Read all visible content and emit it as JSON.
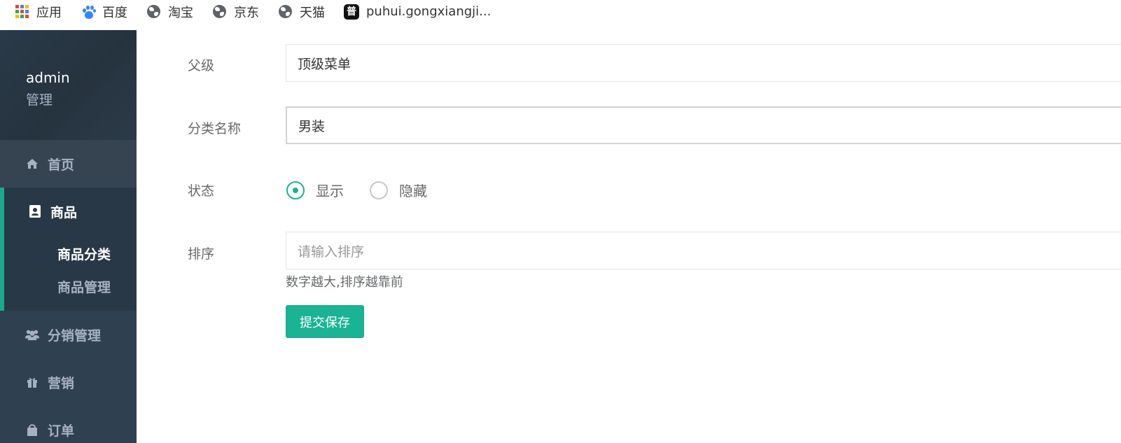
{
  "bookmarks": [
    {
      "label": "应用",
      "icon": "apps-grid-icon"
    },
    {
      "label": "百度",
      "icon": "baidu-paw-icon"
    },
    {
      "label": "淘宝",
      "icon": "globe-icon"
    },
    {
      "label": "京东",
      "icon": "globe-icon"
    },
    {
      "label": "天猫",
      "icon": "globe-icon"
    },
    {
      "label": "puhui.gongxiangji...",
      "icon": "pu-site-icon",
      "icon_text": "普"
    }
  ],
  "sidebar": {
    "profile": {
      "name": "admin",
      "role": "管理"
    },
    "items": [
      {
        "label": "首页",
        "icon": "home-icon"
      },
      {
        "label": "商品",
        "icon": "address-book-icon",
        "active": true,
        "children": [
          {
            "label": "商品分类",
            "active": true
          },
          {
            "label": "商品管理"
          }
        ]
      },
      {
        "label": "分销管理",
        "icon": "users-icon"
      },
      {
        "label": "营销",
        "icon": "gift-icon"
      },
      {
        "label": "订单",
        "icon": "shopping-bag-icon"
      }
    ]
  },
  "form": {
    "parent": {
      "label": "父级",
      "value": "顶级菜单"
    },
    "category_name": {
      "label": "分类名称",
      "value": "男装"
    },
    "status": {
      "label": "状态",
      "options": [
        {
          "label": "显示",
          "checked": true
        },
        {
          "label": "隐藏",
          "checked": false
        }
      ]
    },
    "sort": {
      "label": "排序",
      "placeholder": "请输入排序",
      "help": "数字越大,排序越靠前"
    },
    "submit_label": "提交保存"
  },
  "colors": {
    "sidebar_bg": "#2f4050",
    "accent": "#1ab394",
    "sidebar_text": "#a7b1c2"
  }
}
